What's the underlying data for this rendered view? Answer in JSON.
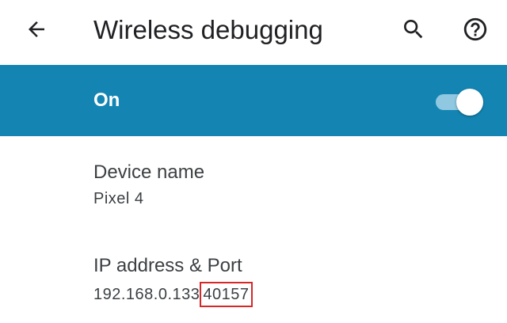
{
  "app_bar": {
    "title": "Wireless debugging",
    "icons": {
      "back": "arrow-back-icon",
      "search": "search-icon",
      "help": "help-circle-icon"
    }
  },
  "master_switch": {
    "label": "On",
    "checked": true,
    "colors": {
      "bar": "#1485b3",
      "track": "#8fc8e0",
      "thumb": "#ffffff"
    }
  },
  "preferences": {
    "device_name": {
      "title": "Device name",
      "summary": "Pixel 4"
    },
    "ip_port": {
      "title": "IP address & Port",
      "ip": "192.168.0.133",
      "port": "40157",
      "highlight_color": "#d62828"
    }
  }
}
